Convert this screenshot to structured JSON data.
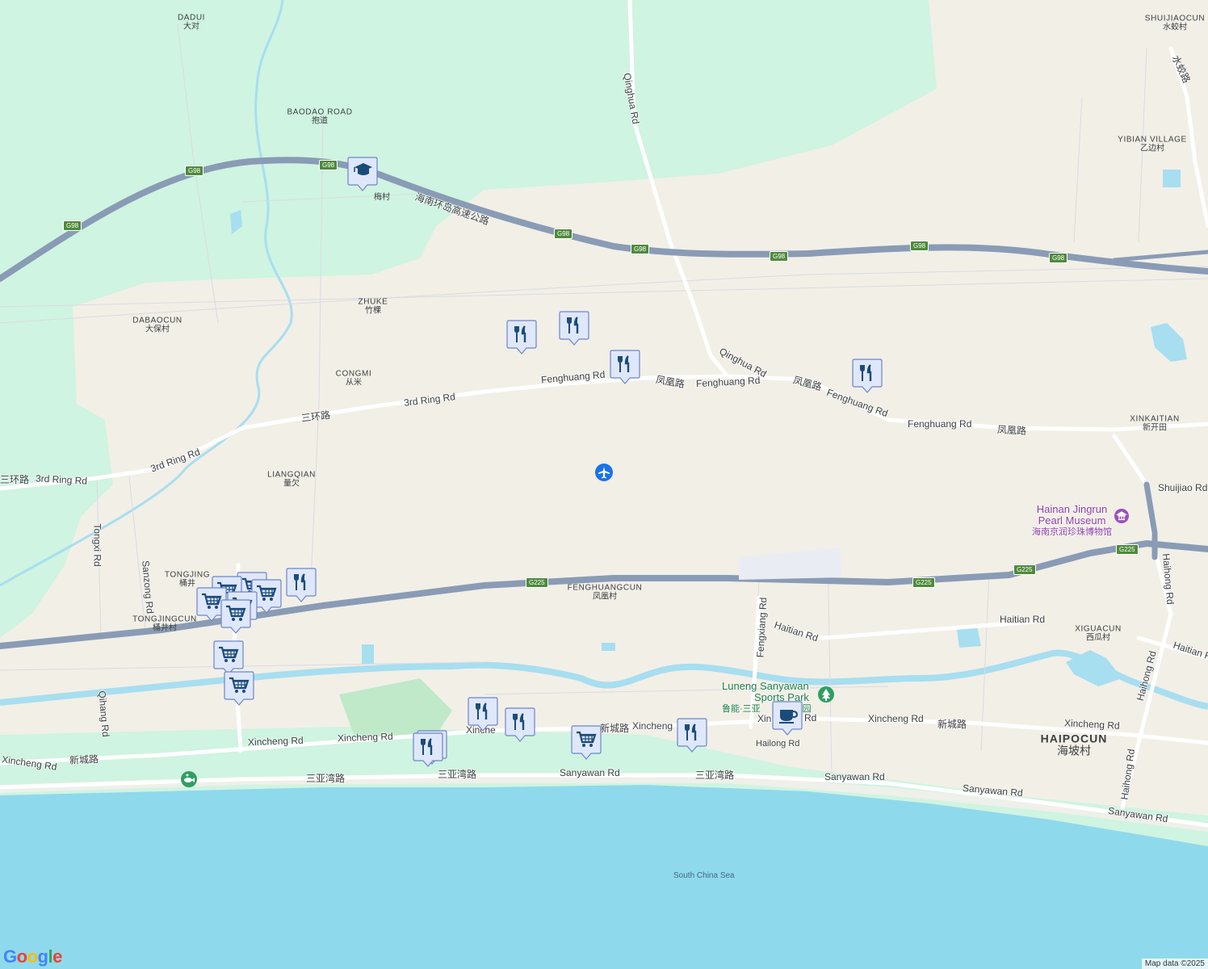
{
  "places": {
    "dadui": {
      "en": "DADUI",
      "zh": "大对"
    },
    "baodao": {
      "en": "BAODAO ROAD",
      "zh": "抱道"
    },
    "meicun": {
      "zh": "梅村"
    },
    "zhuke": {
      "en": "ZHUKE",
      "zh": "竹棵"
    },
    "dabaocun": {
      "en": "DABAOCUN",
      "zh": "大保村"
    },
    "congmi": {
      "en": "CONGMI",
      "zh": "从米"
    },
    "liangqian": {
      "en": "LIANGQIAN",
      "zh": "量欠"
    },
    "tongjing": {
      "en": "TONGJING",
      "zh": "桶井"
    },
    "tongjingcun": {
      "en": "TONGJINGCUN",
      "zh": "桶井村"
    },
    "fenghuangcun": {
      "en": "FENGHUANGCUN",
      "zh": "凤凰村"
    },
    "shuijiaocun": {
      "en": "SHUIJIAOCUN",
      "zh": "水蛟村"
    },
    "yibian": {
      "en": "YIBIAN VILLAGE",
      "zh": "乙边村"
    },
    "xinkaitian": {
      "en": "XINKAITIAN",
      "zh": "新开田"
    },
    "xiguacun": {
      "en": "XIGUACUN",
      "zh": "西瓜村"
    },
    "haipocun": {
      "en": "HAIPOCUN",
      "zh": "海坡村"
    }
  },
  "roads": {
    "g98": "G98",
    "g225": "G225",
    "huandao": "海南环岛高速公路",
    "qinghua": "Qinghua Rd",
    "qinghua2": "Qinghua Rd",
    "fenghuang1": "Fenghuang Rd",
    "fenghuang_zh1": "凤凰路",
    "fenghuang2": "Fenghuang Rd",
    "fenghuang_zh2": "凤凰路",
    "fenghuang3": "Fenghuang Rd",
    "fenghuang4": "Fenghuang Rd",
    "fenghuang_zh3": "凤凰路",
    "ring1": "3rd Ring Rd",
    "ring_zh1": "三环路",
    "ring2": "3rd Ring Rd",
    "ring_zh2": "三环路",
    "ring3": "3rd Ring Rd",
    "tongxi": "Tongxi Rd",
    "sanzong": "Sanzong Rd",
    "qihang": "Qihang Rd",
    "shuijiao_zh": "水蛟路",
    "shuijiao": "Shuijiao Rd",
    "haihong1": "Haihong Rd",
    "haihong2": "Haihong Rd",
    "haihong3": "Haihong Rd",
    "fengxiang": "Fengxiang Rd",
    "haitian1": "Haitian Rd",
    "haitian2": "Haitian Rd",
    "haitian3": "Haitian Rd",
    "xincheng1": "Xincheng Rd",
    "xincheng_zh1": "新城路",
    "xincheng2": "Xincheng Rd",
    "xincheng3": "Xincheng Rd",
    "xincheng4": "Xinche",
    "xincheng_zh2": "新城路",
    "xincheng5": "Xincheng",
    "xincheng6": "Xin",
    "xincheng7": "Rd",
    "xincheng8": "Xincheng Rd",
    "xincheng_zh3": "新城路",
    "xincheng9": "Xincheng Rd",
    "hailong": "Hailong Rd",
    "sanyawan_zh1": "三亚湾路",
    "sanyawan_zh2": "三亚湾路",
    "sanyawan1": "Sanyawan Rd",
    "sanyawan_zh3": "三亚湾路",
    "sanyawan2": "Sanyawan Rd",
    "sanyawan3": "Sanyawan Rd",
    "sanyawan4": "Sanyawan Rd"
  },
  "pois": {
    "museum": {
      "en1": "Hainan Jingrun",
      "en2": "Pearl Museum",
      "zh": "海南京润珍珠博物馆"
    },
    "sports": {
      "en1": "Luneng Sanyawan",
      "en2": "Sports Park",
      "zh": "鲁能·三亚",
      "zh2": "园"
    }
  },
  "water": {
    "sea": "South China Sea"
  },
  "map_brand": "Google",
  "attribution": "Map data ©2025",
  "colors": {
    "land": "#f2efe7",
    "green": "#cff4e1",
    "water": "#8fd9ec",
    "highway": "#8a9bb5",
    "marker_fill": "#dfe7fb",
    "marker_icon": "#1b4c79"
  },
  "marker_types": [
    "school-icon",
    "restaurant-icon",
    "shopping-cart-icon",
    "coffee-icon",
    "airport-icon",
    "museum-icon",
    "park-icon",
    "aquarium-icon"
  ]
}
